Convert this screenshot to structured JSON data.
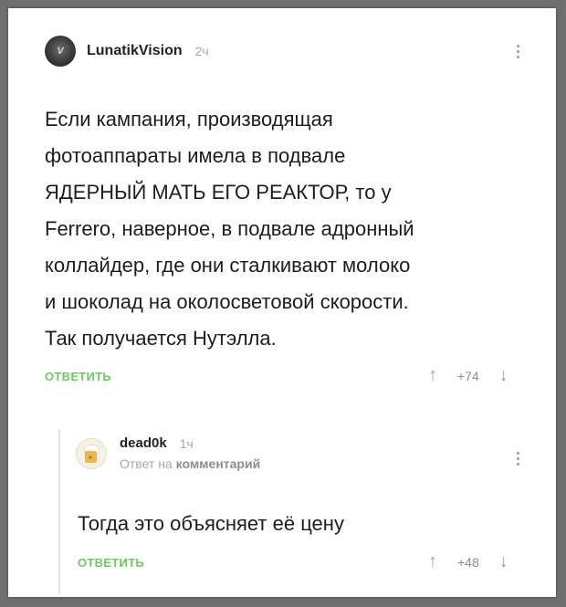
{
  "comment": {
    "username": "LunatikVision",
    "time": "2ч",
    "avatar_text": "V",
    "text": "Если кампания, производящая\nфотоаппараты имела в подвале\nЯДЕРНЫЙ МАТЬ ЕГО РЕАКТОР, то у\nFerrero, наверное, в подвале адронный\nколлайдер, где они сталкивают молоко\nи шоколад на околосветовой скорости.\nТак получается Нутэлла.",
    "reply_label": "ОТВЕТИТЬ",
    "votes": "+74"
  },
  "reply": {
    "username": "dead0k",
    "time": "1ч",
    "reply_to_prefix": "Ответ на",
    "reply_to_link": "комментарий",
    "text": "Тогда это объясняет её цену",
    "reply_label": "ОТВЕТИТЬ",
    "votes": "+48"
  },
  "icons": {
    "upvote": "↑",
    "downvote": "↓"
  },
  "colors": {
    "accent_green": "#74c467",
    "muted": "#a8a8a8"
  }
}
